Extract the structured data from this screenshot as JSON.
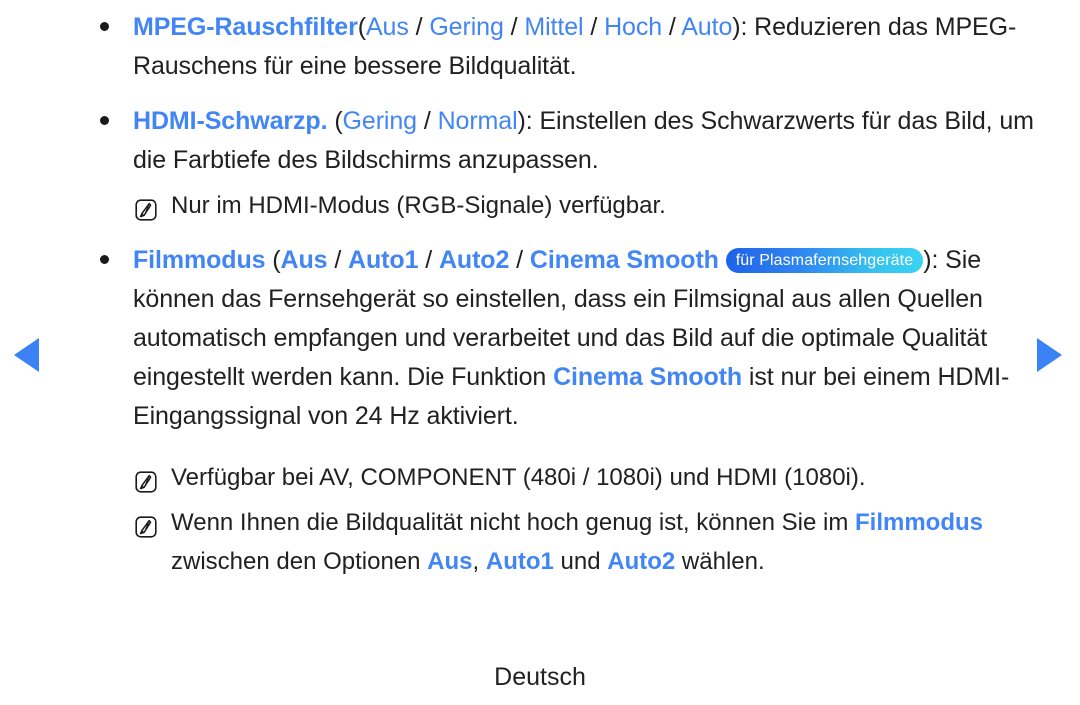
{
  "language_footer": "Deutsch",
  "colors": {
    "link_blue": "#4285f4",
    "arrow_blue": "#3b82f6",
    "badge_from": "#1f62e8",
    "badge_to": "#3ad3f2",
    "text": "#212121"
  },
  "nav": {
    "prev_icon": "triangle-left-icon",
    "next_icon": "triangle-right-icon"
  },
  "bullets": [
    {
      "id": "mpeg-rauschfilter",
      "title": "MPEG-Rauschfilter",
      "options": [
        "Aus",
        "Gering",
        "Mittel",
        "Hoch",
        "Auto"
      ],
      "open_paren": "(",
      "close_paren": ")",
      "separator": "/",
      "description": ": Reduzieren das MPEG-Rauschens für eine bessere Bildqualität."
    },
    {
      "id": "hdmi-schwarzp",
      "title": "HDMI-Schwarzp.",
      "options": [
        "Gering",
        "Normal"
      ],
      "open_paren": "(",
      "close_paren": ")",
      "separator": "/",
      "description": ": Einstellen des Schwarzwerts für das Bild, um die Farbtiefe des Bildschirms anzupassen.",
      "notes": [
        {
          "icon": "note-pencil-icon",
          "text": "Nur im HDMI-Modus (RGB-Signale) verfügbar."
        }
      ]
    },
    {
      "id": "filmmodus",
      "title": "Filmmodus",
      "options": [
        "Aus",
        "Auto1",
        "Auto2",
        "Cinema Smooth"
      ],
      "open_paren": "(",
      "close_paren": ")",
      "separator": "/",
      "badge": "für Plasmafernsehgeräte",
      "description_part1": ": Sie können das Fernsehgerät so einstellen, dass ein Filmsignal aus allen Quellen automatisch empfangen und verarbeitet und das Bild auf die optimale Qualität eingestellt werden kann. Die Funktion ",
      "inline_link": "Cinema Smooth",
      "description_part2": " ist nur bei einem HDMI-Eingangssignal von 24 Hz aktiviert.",
      "notes": [
        {
          "icon": "note-pencil-icon",
          "text": "Verfügbar bei AV, COMPONENT (480i / 1080i) und HDMI (1080i)."
        },
        {
          "icon": "note-pencil-icon",
          "text_part1": "Wenn Ihnen die Bildqualität nicht hoch genug ist, können Sie im ",
          "link1": "Filmmodus",
          "text_part2": " zwischen den Optionen ",
          "link2": "Aus",
          "text_part3": ", ",
          "link3": "Auto1",
          "text_part4": " und ",
          "link4": "Auto2",
          "text_part5": " wählen."
        }
      ]
    }
  ]
}
